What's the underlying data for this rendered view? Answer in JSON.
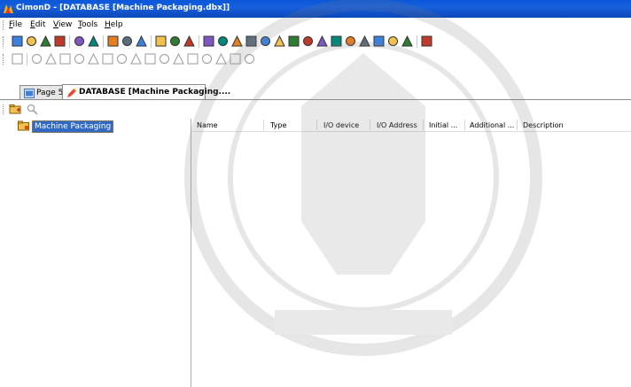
{
  "window": {
    "title": "CimonD - [DATABASE [Machine Packaging.dbx]]"
  },
  "menu": {
    "items": [
      {
        "label": "File",
        "accel": "F",
        "rest": "ile"
      },
      {
        "label": "Edit",
        "accel": "E",
        "rest": "dit"
      },
      {
        "label": "View",
        "accel": "V",
        "rest": "iew"
      },
      {
        "label": "Tools",
        "accel": "T",
        "rest": "ools"
      },
      {
        "label": "Help",
        "accel": "H",
        "rest": "elp"
      }
    ]
  },
  "toolbar_main": {
    "icons": [
      "new-icon",
      "open-icon",
      "save-icon",
      "save-all-icon",
      "print-icon",
      "print-preview-icon",
      "cut-icon",
      "copy-icon",
      "paste-icon",
      "find-icon",
      "replace-icon",
      "delete-icon",
      "tag-wizard-icon",
      "draw-icon",
      "display-icon",
      "network-icon",
      "battery-icon",
      "alarm-icon",
      "database-icon",
      "script-icon",
      "tools-icon",
      "page-icon",
      "object-icon",
      "report-icon",
      "chart-icon",
      "trend-icon",
      "recipe-icon",
      "help-icon"
    ]
  },
  "toolbar_draw": {
    "icons": [
      "pointer-icon",
      "line-icon",
      "rectangle-icon",
      "rounded-rect-icon",
      "ellipse-icon",
      "arc-icon",
      "polygon-icon",
      "polyline-icon",
      "gear-icon",
      "lamp-icon",
      "text-icon",
      "bitmap-icon",
      "button-icon",
      "group-icon",
      "ungroup-icon",
      "frame-icon",
      "image-icon"
    ]
  },
  "tabs": [
    {
      "label": "Page 5",
      "icon": "page-icon",
      "active": false
    },
    {
      "label": "DATABASE [Machine Packaging....",
      "icon": "database-tab-icon",
      "active": true
    }
  ],
  "panel_toolbar": {
    "icons": [
      "add-group-icon",
      "search-icon"
    ]
  },
  "tree": {
    "root": "Machine Packaging"
  },
  "list": {
    "columns": [
      "Name",
      "Type",
      "I/O device",
      "I/O Address",
      "Initial ...",
      "Additional ...",
      "Description"
    ]
  },
  "colors": {
    "title_bar": "#0a57d9",
    "selection": "#316ac5"
  }
}
